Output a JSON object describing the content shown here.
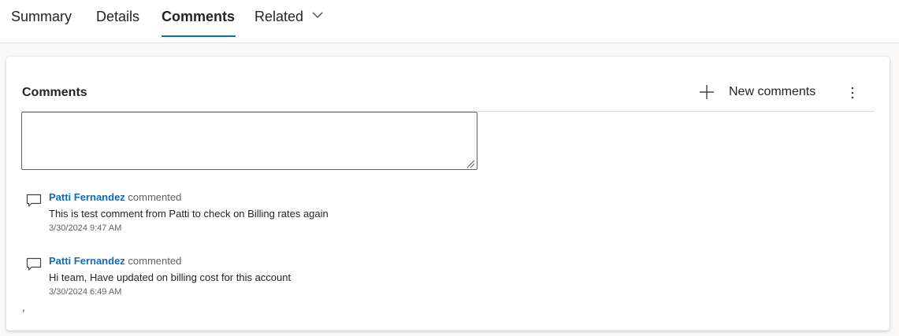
{
  "tabs": {
    "summary": "Summary",
    "details": "Details",
    "comments": "Comments",
    "related": "Related"
  },
  "panel": {
    "title": "Comments",
    "new_label": "New comments"
  },
  "comment_input": {
    "value": ""
  },
  "comments": [
    {
      "author": "Patti Fernandez",
      "verb": "commented",
      "text": "This is test comment from Patti to check on Billing rates again",
      "time": "3/30/2024 9:47 AM"
    },
    {
      "author": "Patti Fernandez",
      "verb": "commented",
      "text": "Hi team, Have updated on billing cost for this account",
      "time": "3/30/2024 6:49 AM"
    }
  ],
  "stray_text": ",",
  "colors": {
    "accent": "#0f6cbd",
    "text": "#242424",
    "muted": "#616161",
    "background": "#faf9f8"
  }
}
